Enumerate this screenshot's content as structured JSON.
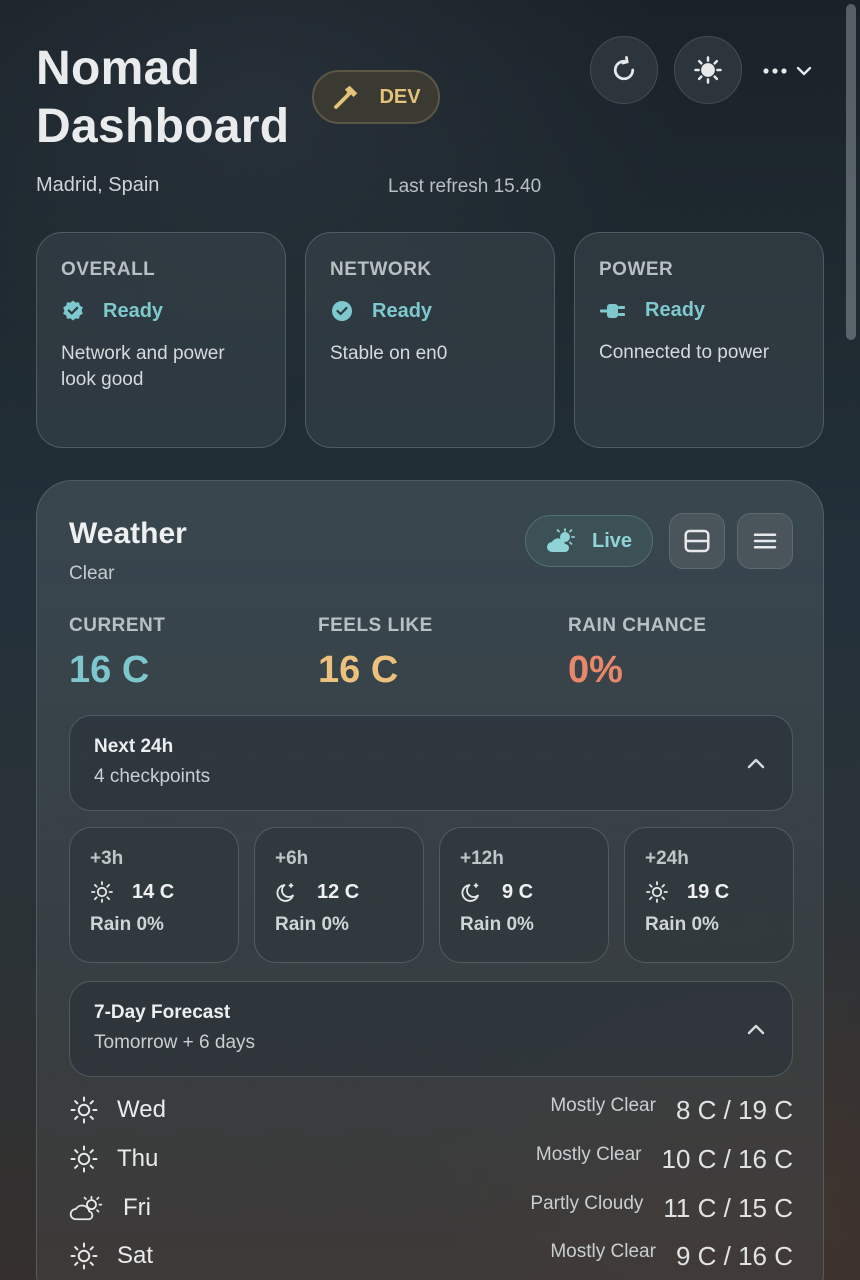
{
  "app": {
    "title_line1": "Nomad",
    "title_line2": "Dashboard",
    "badge": "DEV",
    "location": "Madrid, Spain",
    "last_refresh": "Last refresh 15.40"
  },
  "toolbar": {
    "refresh_icon": "refresh-icon",
    "theme_icon": "sun-icon",
    "more_icon": "more-dots-icon"
  },
  "status_cards": [
    {
      "label": "OVERALL",
      "state": "Ready",
      "desc": "Network and power look good",
      "icon": "verified-badge-icon"
    },
    {
      "label": "NETWORK",
      "state": "Ready",
      "desc": "Stable on en0",
      "icon": "check-circle-icon"
    },
    {
      "label": "POWER",
      "state": "Ready",
      "desc": "Connected to power",
      "icon": "plug-icon"
    }
  ],
  "weather": {
    "title": "Weather",
    "condition": "Clear",
    "live_label": "Live",
    "metrics": [
      {
        "label": "CURRENT",
        "value": "16 C",
        "color": "#7cc6cc"
      },
      {
        "label": "FEELS LIKE",
        "value": "16 C",
        "color": "#ecc17d"
      },
      {
        "label": "RAIN CHANCE",
        "value": "0%",
        "color": "#e9876b"
      }
    ],
    "next24": {
      "title": "Next 24h",
      "subtitle": "4 checkpoints"
    },
    "hourly": [
      {
        "label": "+3h",
        "temp": "14 C",
        "rain": "Rain 0%",
        "icon": "sun-icon"
      },
      {
        "label": "+6h",
        "temp": "12 C",
        "rain": "Rain 0%",
        "icon": "moon-icon"
      },
      {
        "label": "+12h",
        "temp": "9 C",
        "rain": "Rain 0%",
        "icon": "moon-icon"
      },
      {
        "label": "+24h",
        "temp": "19 C",
        "rain": "Rain 0%",
        "icon": "sun-icon"
      }
    ],
    "forecast": {
      "title": "7-Day Forecast",
      "subtitle": "Tomorrow + 6 days"
    },
    "days": [
      {
        "day": "Wed",
        "cond": "Mostly Clear",
        "temps": "8 C / 19 C",
        "icon": "sun-icon"
      },
      {
        "day": "Thu",
        "cond": "Mostly Clear",
        "temps": "10 C / 16 C",
        "icon": "sun-icon"
      },
      {
        "day": "Fri",
        "cond": "Partly Cloudy",
        "temps": "11 C / 15 C",
        "icon": "partly-cloudy-icon"
      },
      {
        "day": "Sat",
        "cond": "Mostly Clear",
        "temps": "9 C / 16 C",
        "icon": "sun-icon"
      }
    ]
  }
}
